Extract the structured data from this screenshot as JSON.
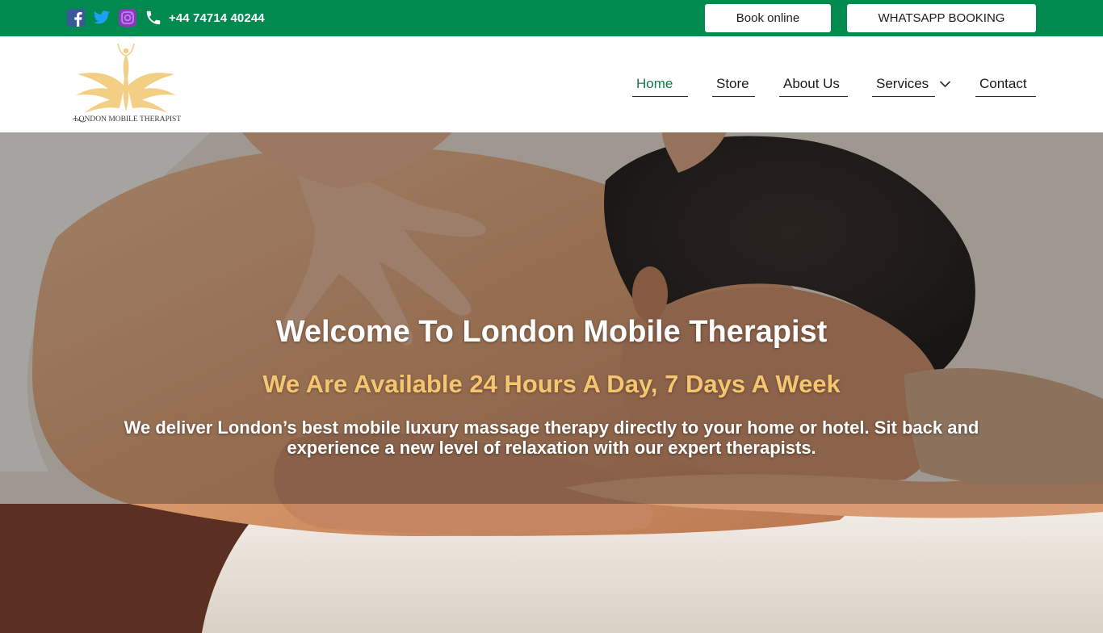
{
  "topbar": {
    "phone": "+44 74714 40244",
    "book_label": "Book online",
    "whatsapp_label": "WHATSAPP BOOKING",
    "colors": {
      "background": "#008a4f",
      "facebook": "#3b5998",
      "twitter": "#1da1f2",
      "instagram": "#8a3ab9"
    },
    "icons": [
      "facebook-icon",
      "twitter-icon",
      "instagram-icon",
      "phone-icon"
    ]
  },
  "brand": {
    "logo_text": "LONDON MOBILE THERAPIST",
    "logo_color": "#f2cf85"
  },
  "nav": {
    "items": [
      {
        "label": "Home",
        "active": true
      },
      {
        "label": "Store"
      },
      {
        "label": "About Us"
      },
      {
        "label": "Services",
        "has_dropdown": true
      },
      {
        "label": "Contact"
      }
    ],
    "active_color": "#0f7c4a"
  },
  "hero": {
    "title": "Welcome To London Mobile Therapist",
    "subtitle": "We Are Available 24 Hours A Day, 7 Days A Week",
    "description": "We deliver London’s best mobile luxury massage therapy directly to your home or hotel. Sit back and experience a new level of relaxation with our expert therapists.",
    "subtitle_color": "#f5c56f"
  }
}
